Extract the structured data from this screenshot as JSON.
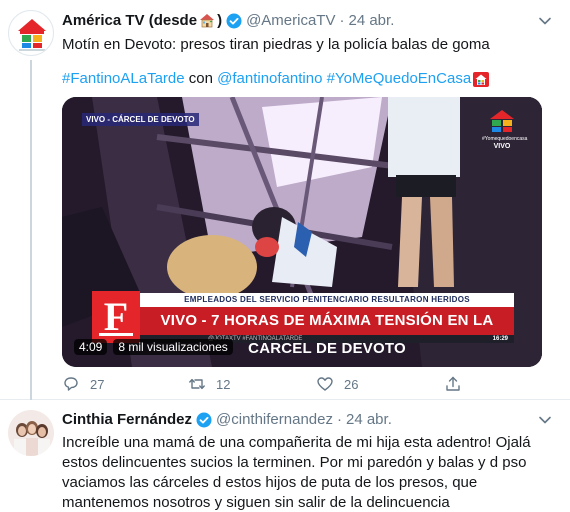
{
  "colors": {
    "link": "#1da1f2",
    "text": "#14171a",
    "muted": "#657786",
    "verified": "#1da1f2",
    "banner_red": "#c81d25",
    "f_logo_red": "#e4262b"
  },
  "tweet1": {
    "name": "América TV (desde",
    "handle": "@AmericaTV",
    "separator": "·",
    "date": "24 abr.",
    "text": "Motín en Devoto: presos tiran piedras y la policía balas de goma",
    "hashtag1": "#FantinoALaTarde",
    "connector": "con",
    "mention": "@fantinofantino",
    "hashtag2": "#YoMeQuedoEnCasa",
    "media": {
      "location_label": "VIVO - CÁRCEL DE DEVOTO",
      "logo_hashtag": "#Yomequedoencasa",
      "logo_live": "VIVO",
      "banner_top": "EMPLEADOS DEL SERVICIO PENITENCIARIO RESULTARON HERIDOS",
      "banner_main": "VIVO - 7 HORAS DE MÁXIMA TENSIÓN EN LA CÁRCEL DE DEVOTO",
      "banner_bottom": "@JOTAXTV   #FANTINOALATARDE",
      "banner_time": "16:29",
      "f_logo_letter": "F",
      "duration": "4:09",
      "views": "8 mil visualizaciones"
    },
    "actions": {
      "reply_count": "27",
      "retweet_count": "12",
      "like_count": "26"
    }
  },
  "tweet2": {
    "name": "Cinthia Fernández",
    "handle": "@cinthifernandez",
    "separator": "·",
    "date": "24 abr.",
    "text": "Increíble una mamá de una compañerita de mi hija esta adentro! Ojalá estos delincuentes sucios la terminen. Por mi paredón y balas y d pso vaciamos las cárceles d estos hijos de puta de los presos, que mantenemos nosotros y siguen sin salir de la delincuencia"
  }
}
